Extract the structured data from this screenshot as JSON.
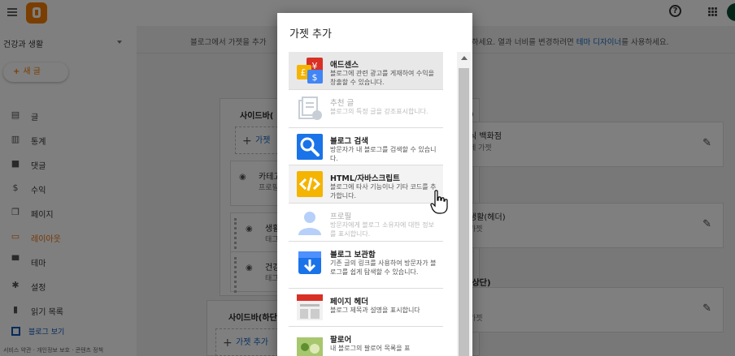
{
  "sidebar": {
    "blog_name": "건강과 생활",
    "new_post": "새 글",
    "items": [
      {
        "icon": "posts-icon",
        "label": "글"
      },
      {
        "icon": "stats-icon",
        "label": "통계"
      },
      {
        "icon": "comments-icon",
        "label": "댓글"
      },
      {
        "icon": "earnings-icon",
        "label": "수익"
      },
      {
        "icon": "pages-icon",
        "label": "페이지"
      },
      {
        "icon": "layout-icon",
        "label": "레이아웃",
        "active": true
      },
      {
        "icon": "theme-icon",
        "label": "테마"
      },
      {
        "icon": "settings-icon",
        "label": "설정"
      },
      {
        "icon": "reading-list-icon",
        "label": "읽기 목록"
      }
    ],
    "view_blog": "블로그 보기",
    "footer": "서비스 약관 · 개인정보 보호 · 콘텐츠 정책"
  },
  "main": {
    "hint_left": "블로그에서 가젯을 추가",
    "hint_right_prefix": "하세요. 열과 너비를 변경하려면 ",
    "hint_right_link": "테마 디자이너",
    "hint_right_suffix": "를 사용하세요.",
    "panel1_title": "사이드바(",
    "panel1_add": "가젯",
    "panel1_gadgets": [
      {
        "title": "카테고",
        "sub": "프로필"
      },
      {
        "title": "생활",
        "sub": "태그"
      },
      {
        "title": "건강",
        "sub": "태그"
      }
    ],
    "panel2_title": "사이드바(하단",
    "panel2_add": "가젯 추가",
    "right_sections": [
      {
        "title_fragment": "식 백화점",
        "sub_fragment": "페 가젯"
      },
      {
        "title_fragment": "생활(헤더)",
        "sub_fragment": "가젯"
      },
      {
        "title_fragment": "(상단)",
        "sub_fragment": "가젯"
      }
    ],
    "right_header_fragment": ")"
  },
  "dialog": {
    "title": "가젯 추가",
    "gadgets": [
      {
        "name": "애드센스",
        "desc": "블로그에 관련 광고를 게재하여 수익을 창출할 수 있습니다.",
        "icon": "adsense-icon",
        "state": "selected"
      },
      {
        "name": "추천 글",
        "desc": "블로그의 특정 글을 강조표시합니다.",
        "icon": "featured-post-icon",
        "state": "disabled"
      },
      {
        "name": "블로그 검색",
        "desc": "방문자가 내 블로그를 검색할 수 있습니다.",
        "icon": "blog-search-icon",
        "state": "normal"
      },
      {
        "name": "HTML/자바스크립트",
        "desc": "블로그에 타사 기능이나 기타 코드를 추가합니다.",
        "icon": "html-js-icon",
        "state": "hover"
      },
      {
        "name": "프로필",
        "desc": "방문자에게 블로그 소유자에 대한 정보를 표시합니다.",
        "icon": "profile-icon",
        "state": "disabled"
      },
      {
        "name": "블로그 보관함",
        "desc": "기존 글의 링크를 사용하여 방문자가 블로그를 쉽게 탐색할 수 있습니다.",
        "icon": "blog-archive-icon",
        "state": "normal"
      },
      {
        "name": "페이지 헤더",
        "desc": "블로그 제목과 설명을 표시합니다",
        "icon": "page-header-icon",
        "state": "normal"
      },
      {
        "name": "팔로어",
        "desc": "내 블로그의 팔로어 목록을 표",
        "icon": "followers-icon",
        "state": "normal"
      }
    ]
  },
  "colors": {
    "brand": "#f57d00",
    "active_nav": "#e8710a",
    "link": "#1565c0"
  }
}
